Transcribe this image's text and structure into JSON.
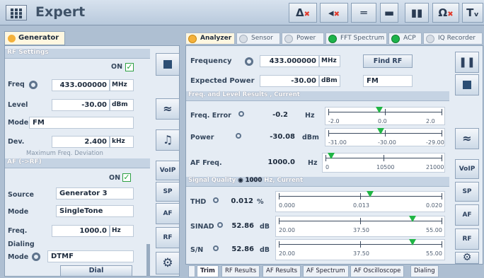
{
  "app": {
    "title": "Expert"
  },
  "left": {
    "tab": "Generator",
    "rf": {
      "header": "RF Settings",
      "on_label": "ON",
      "freq_label": "Freq",
      "freq_value": "433.000000",
      "freq_unit": "MHz",
      "level_label": "Level",
      "level_value": "-30.00",
      "level_unit": "dBm",
      "mode_label": "Mode",
      "mode_value": "FM",
      "dev_label": "Dev.",
      "dev_value": "2.400",
      "dev_unit": "kHz",
      "dev_hint": "Maximum Freq. Deviation"
    },
    "af": {
      "header": "AF (->RF)",
      "on_label": "ON",
      "source_label": "Source",
      "source_value": "Generator 3",
      "mode_label": "Mode",
      "mode_value": "SingleTone",
      "freq_label": "Freq.",
      "freq_value": "1000.0",
      "freq_unit": "Hz",
      "dialing_label": "Dialing",
      "dial_mode_label": "Mode",
      "dial_mode_value": "DTMF",
      "dial_button": "Dial"
    },
    "side_buttons": [
      "VoIP",
      "SP",
      "AF",
      "RF"
    ]
  },
  "right": {
    "tabs": [
      "Analyzer",
      "Sensor",
      "Power",
      "FFT Spectrum",
      "ACP",
      "IQ Recorder"
    ],
    "freq_label": "Frequency",
    "freq_value": "433.000000",
    "freq_unit": "MHz",
    "find_rf": "Find RF",
    "exp_power_label": "Expected Power",
    "exp_power_value": "-30.00",
    "exp_power_unit": "dBm",
    "mode_value": "FM",
    "results_header": "Freq. and Level Results , Current",
    "freq_error": {
      "label": "Freq. Error",
      "value": "-0.2",
      "unit": "Hz",
      "scale": [
        "-2.0",
        "0.0",
        "2.0"
      ],
      "level": 0.45
    },
    "power": {
      "label": "Power",
      "value": "-30.08",
      "unit": "dBm",
      "scale": [
        "-31.00",
        "-30.00",
        "-29.00"
      ],
      "level": 0.46
    },
    "af_freq": {
      "label": "AF Freq.",
      "value": "1000.0",
      "unit": "Hz",
      "scale": [
        "0",
        "10500",
        "21000"
      ],
      "level": 0.05
    },
    "sq_header_a": "Signal Quality",
    "sq_header_b": "1000",
    "sq_header_c": "Hz, Current",
    "thd": {
      "label": "THD",
      "value": "0.012",
      "unit": "%",
      "scale": [
        "0.000",
        "0.013",
        "0.020"
      ],
      "level": 0.56
    },
    "sinad": {
      "label": "SINAD",
      "value": "52.86",
      "unit": "dB",
      "scale": [
        "20.00",
        "37.50",
        "55.00"
      ],
      "level": 0.82
    },
    "sn": {
      "label": "S/N",
      "value": "52.86",
      "unit": "dB",
      "scale": [
        "20.00",
        "37.50",
        "55.00"
      ],
      "level": 0.82
    },
    "bottom_tabs": [
      "Trim",
      "RF Results",
      "AF Results",
      "AF Spectrum",
      "AF Oscilloscope",
      "Dialing"
    ],
    "side_buttons": [
      "VoIP",
      "SP",
      "AF",
      "RF"
    ]
  },
  "colors": {
    "accent_green": "#1db34a",
    "error_red": "#e13b2c",
    "tab_orange": "#f4b13a"
  }
}
